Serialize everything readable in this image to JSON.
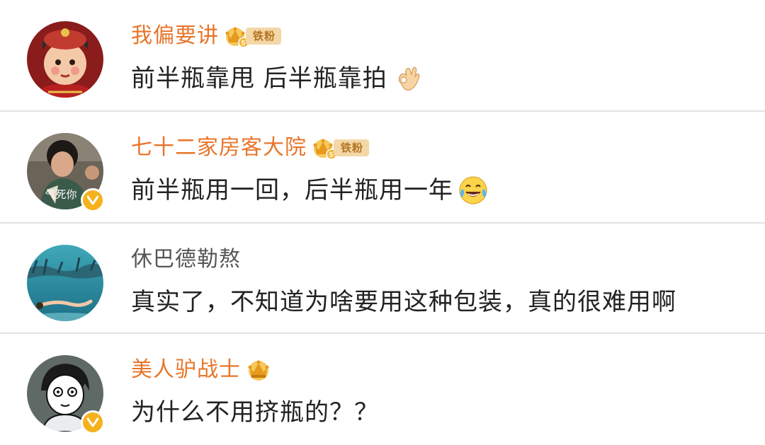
{
  "comments": [
    {
      "username": "我偏要讲",
      "fan_label": "铁粉",
      "level": "5",
      "text": "前半瓶靠甩 后半瓶靠拍",
      "emoji": "ok-hand-emoji"
    },
    {
      "username": "七十二家房客大院",
      "fan_label": "铁粉",
      "level": "5",
      "text": "前半瓶用一回，后半瓶用一年",
      "emoji": "laugh-cry-emoji",
      "avatar_caption": "气死你"
    },
    {
      "username": "休巴德勒熬",
      "text": "真实了，不知道为啥要用这种包装，真的很难用啊"
    },
    {
      "username": "美人驴战士",
      "text": "为什么不用挤瓶的？？"
    }
  ],
  "colors": {
    "username_vip": "#e8752a",
    "username_plain": "#555555",
    "text": "#222222",
    "divider": "#e2e2e2",
    "fan_tag_bg": "#f3d7a6",
    "verified": "#f5b21d"
  }
}
